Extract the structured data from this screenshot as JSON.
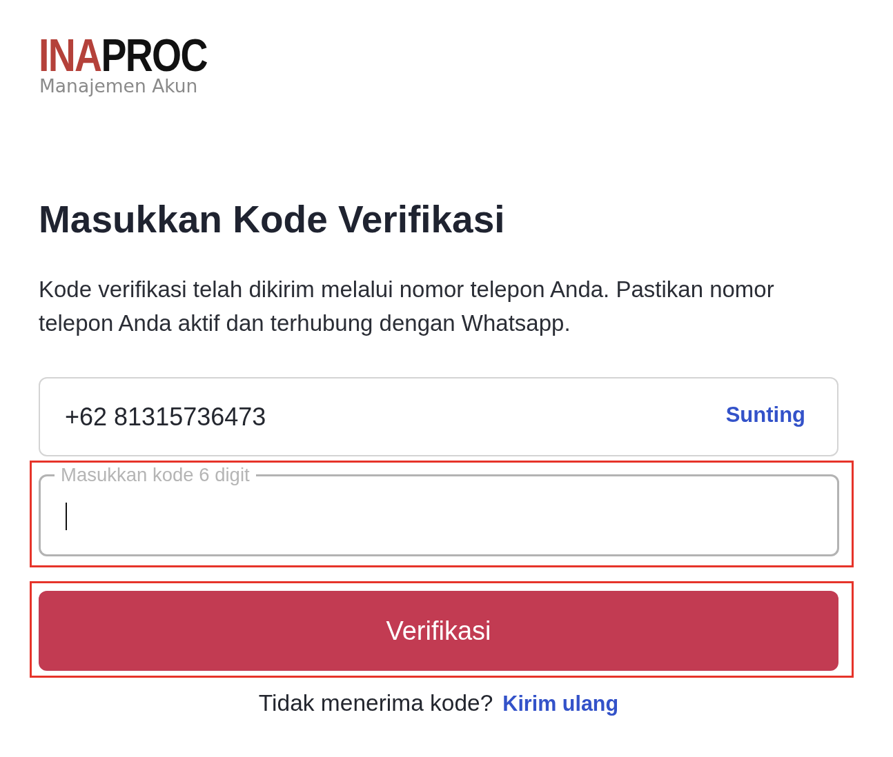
{
  "logo": {
    "part_1": "INA",
    "part_2": "PROC",
    "subtitle": "Manajemen Akun"
  },
  "heading": "Masukkan Kode Verifikasi",
  "description": "Kode verifikasi telah dikirim melalui nomor telepon Anda. Pastikan nomor telepon Anda aktif dan terhubung dengan Whatsapp.",
  "phone": {
    "value": "+62 81315736473",
    "edit_link": "Sunting"
  },
  "code_field": {
    "label": "Masukkan kode 6 digit",
    "focused": true,
    "highlighted": true
  },
  "submit_button": {
    "label": "Verifikasi",
    "highlighted": true
  },
  "resend": {
    "prompt": "Tidak menerima kode?",
    "link": "Kirim ulang"
  }
}
